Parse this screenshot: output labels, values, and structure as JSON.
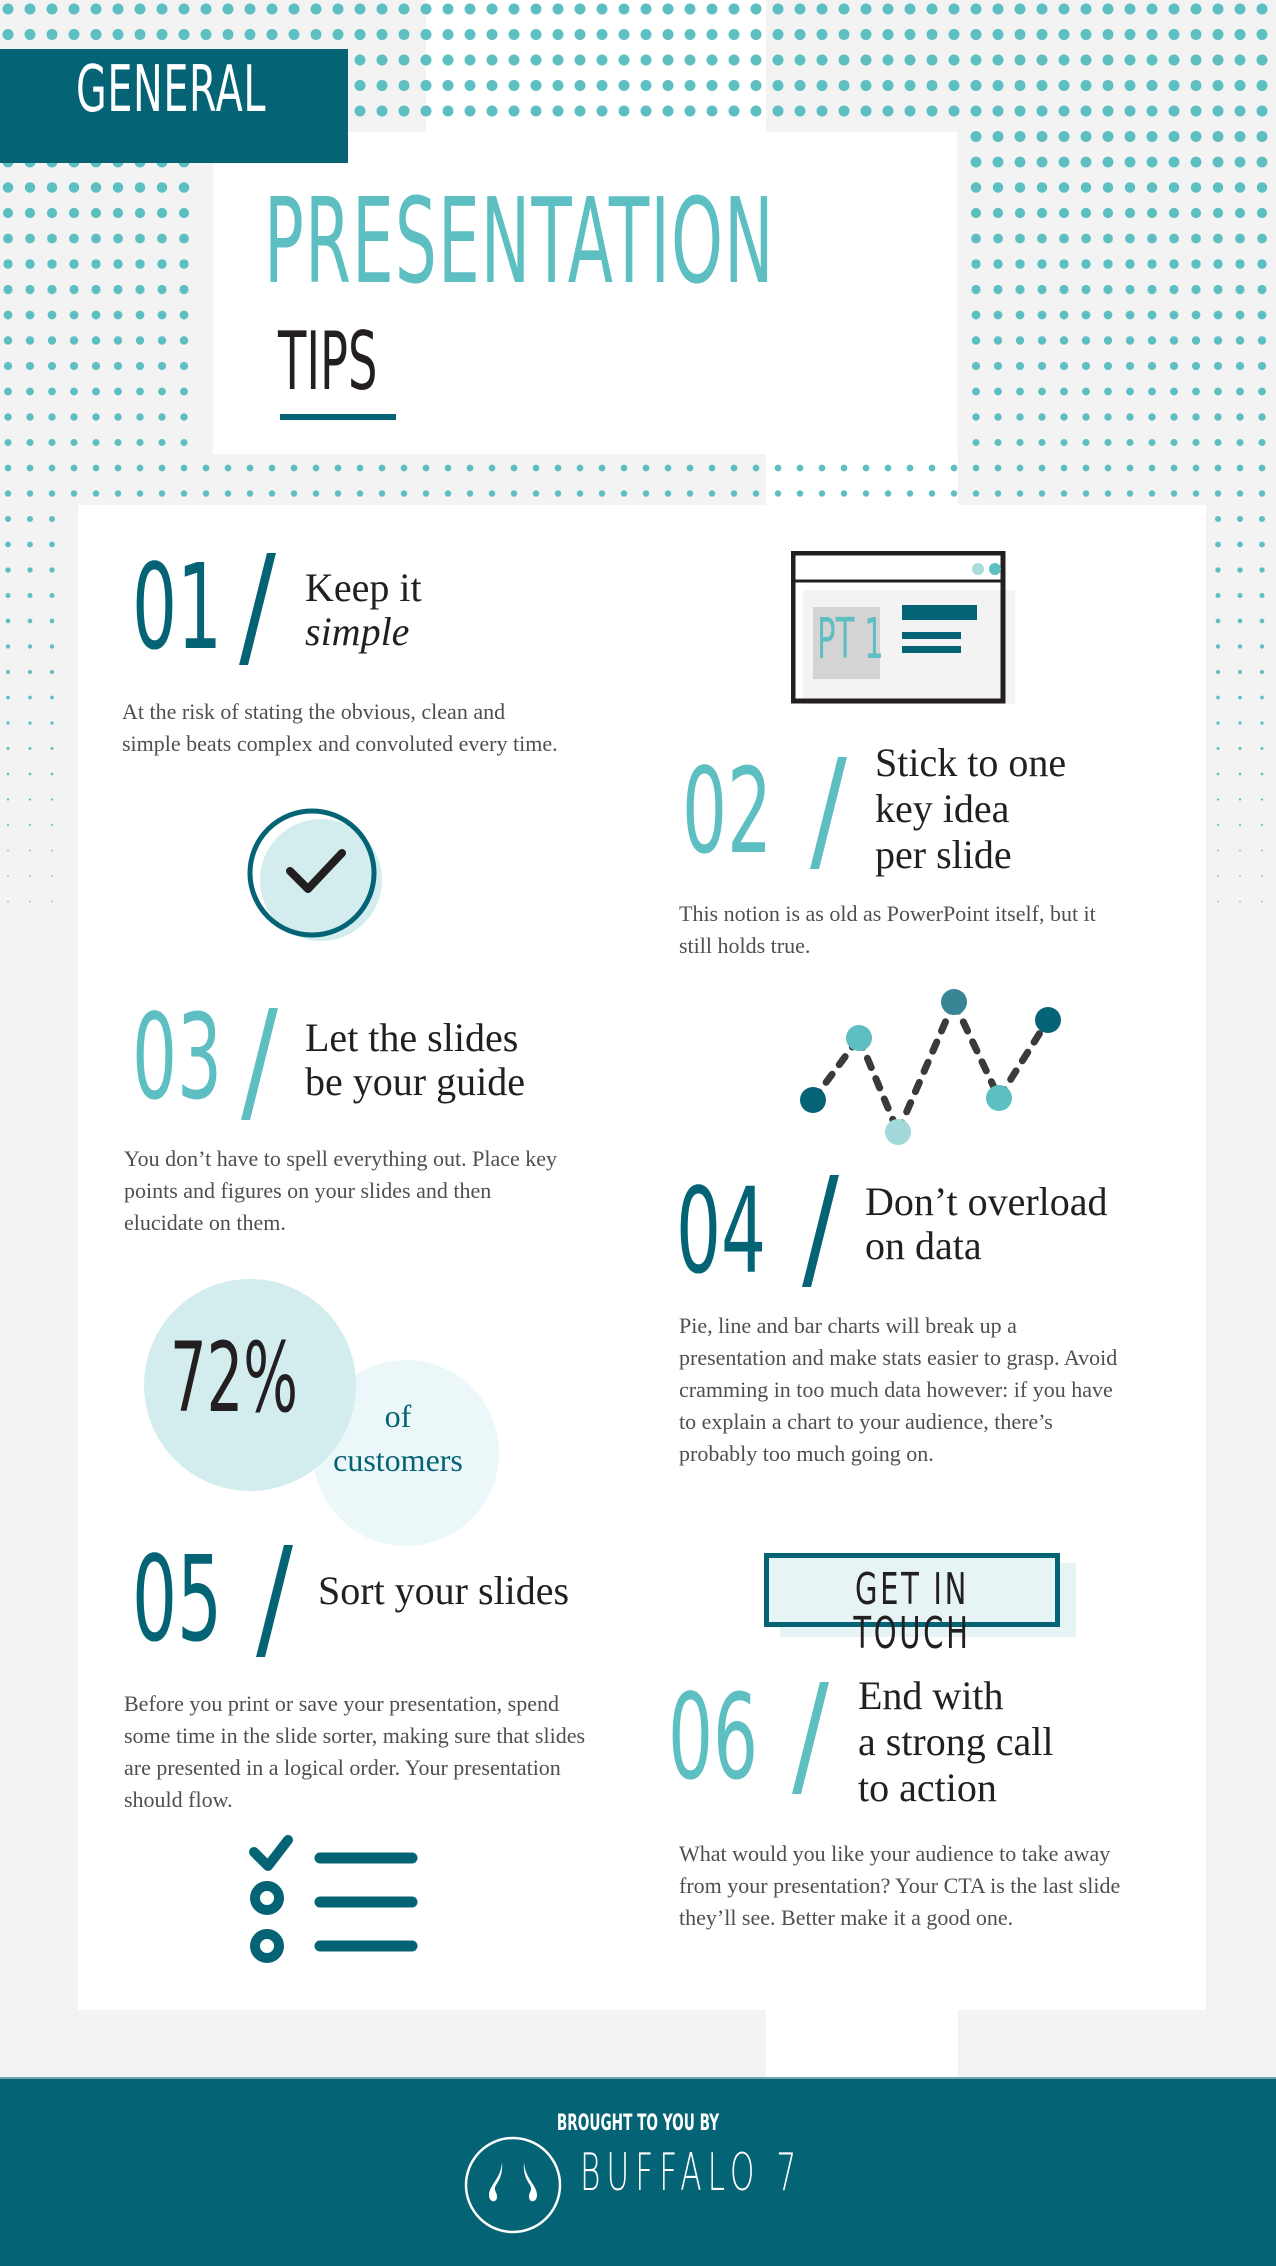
{
  "header": {
    "badge": "GENERAL",
    "title": "PRESENTATION",
    "subtitle": "TIPS"
  },
  "colors": {
    "teal": "#5dbfc1",
    "dark_teal": "#046375",
    "light_teal": "#d3edef",
    "text_dark": "#231f20",
    "text_body": "#4f4f4f",
    "background": "#f3f3f3"
  },
  "tips": [
    {
      "number": "01",
      "heading_line1": "Keep it",
      "heading_line2": "simple",
      "body": "At the risk of stating the obvious, clean and simple beats complex and convoluted every time."
    },
    {
      "number": "02",
      "heading_line1": "Stick to one",
      "heading_line2": "key idea",
      "heading_line3": "per slide",
      "body": "This notion is as old as PowerPoint itself, but it still holds true."
    },
    {
      "number": "03",
      "heading_line1": "Let the slides",
      "heading_line2": "be your guide",
      "body": "You don’t have to spell everything out. Place key points and figures on your slides and then elucidate on them."
    },
    {
      "number": "04",
      "heading_line1": "Don’t overload",
      "heading_line2": "on data",
      "body": "Pie, line and bar charts will break up a presentation and make stats easier to grasp. Avoid cramming in too much data however: if you have to explain a chart to your audience, there’s probably too much going on."
    },
    {
      "number": "05",
      "heading_line1": "Sort your slides",
      "body": "Before you print or save your presentation, spend some time in the slide sorter, making sure that slides are presented in a logical order. Your presentation should flow."
    },
    {
      "number": "06",
      "heading_line1": "End with",
      "heading_line2": "a strong call",
      "heading_line3": "to action",
      "body": "What would you like your audience to take away from your presentation? Your CTA is the last slide they’ll see. Better make it a good one."
    }
  ],
  "illustrations": {
    "slide_label": "PT 1",
    "stat_value": "72%",
    "stat_label_line1": "of",
    "stat_label_line2": "customers",
    "cta_label": "GET IN TOUCH",
    "icons": [
      "checkmark-circle-icon",
      "slide-window-icon",
      "dotted-line-chart-icon",
      "checklist-icon"
    ]
  },
  "footer": {
    "brought_by": "BROUGHT TO YOU BY",
    "brand": "BUFFALO 7",
    "logo_icon": "buffalo-horns-logo-icon"
  }
}
